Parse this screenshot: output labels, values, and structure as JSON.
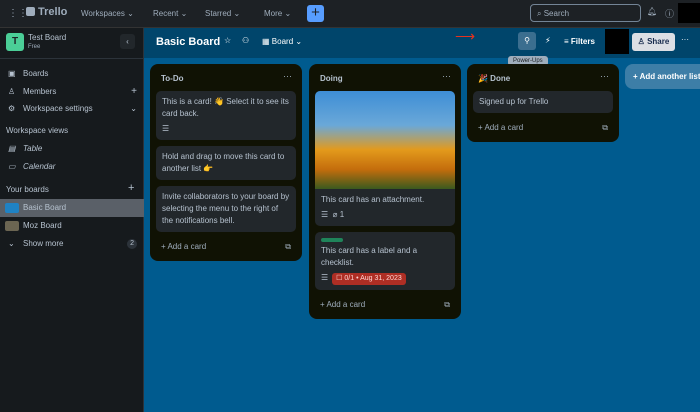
{
  "topbar": {
    "brand": "Trello",
    "nav": [
      "Workspaces",
      "Recent",
      "Starred",
      "More"
    ],
    "search_placeholder": "Search"
  },
  "sidebar": {
    "workspace": "Test Board",
    "plan": "Free",
    "initial": "T",
    "items": [
      {
        "label": "Boards",
        "icon": "board-icon"
      },
      {
        "label": "Members",
        "icon": "person-icon"
      },
      {
        "label": "Workspace settings",
        "icon": "gear-icon"
      }
    ],
    "views_header": "Workspace views",
    "views": [
      {
        "label": "Table"
      },
      {
        "label": "Calendar"
      }
    ],
    "boards_header": "Your boards",
    "boards": [
      {
        "label": "Basic Board",
        "color": "#1f82c4"
      },
      {
        "label": "Moz Board"
      }
    ],
    "show_more": "Show more",
    "show_more_count": "2"
  },
  "board": {
    "title": "Basic Board",
    "view": "Board",
    "filters": "Filters",
    "share": "Share",
    "tooltip": "Power-Ups",
    "add_list": "Add another list"
  },
  "lists": [
    {
      "title": "To-Do",
      "cards": [
        {
          "text": "This is a card! 👋 Select it to see its card back."
        },
        {
          "text": "Hold and drag to move this card to another list 👉"
        },
        {
          "text": "Invite collaborators to your board by selecting the menu to the right of the notifications bell."
        }
      ],
      "add": "Add a card"
    },
    {
      "title": "Doing",
      "cards": [
        {
          "text": "This card has an attachment.",
          "attachments": "1"
        },
        {
          "text": "This card has a label and a checklist.",
          "label_color": "#1f845a",
          "checklist": "0/1 • Aug 31, 2023"
        }
      ],
      "add": "Add a card"
    },
    {
      "title": "🎉 Done",
      "cards": [
        {
          "text": "Signed up for Trello"
        }
      ],
      "add": "Add a card"
    }
  ]
}
